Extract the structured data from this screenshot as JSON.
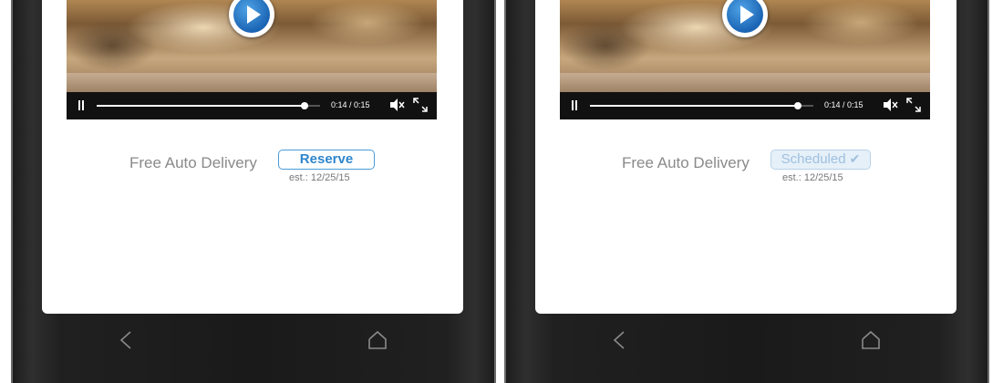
{
  "screens": [
    {
      "video": {
        "time": "0:14 / 0:15",
        "progress_fraction": 0.93
      },
      "delivery": {
        "label": "Free Auto Delivery",
        "button_label": "Reserve",
        "est": "est.: 12/25/15"
      }
    },
    {
      "video": {
        "time": "0:14 / 0:15",
        "progress_fraction": 0.93
      },
      "delivery": {
        "label": "Free Auto Delivery",
        "button_label": "Scheduled",
        "est": "est.: 12/25/15"
      }
    }
  ],
  "icons": {
    "play": "play-icon",
    "pause": "pause-icon",
    "mute": "speaker-muted-icon",
    "fullscreen": "fullscreen-icon",
    "check": "check-icon",
    "back": "back-chevron-icon",
    "home": "home-icon"
  },
  "colors": {
    "accent_blue": "#2f86cc",
    "scheduled_blue": "#9dc0e0",
    "label_gray": "#8a8a8a",
    "control_bar": "#111111"
  }
}
